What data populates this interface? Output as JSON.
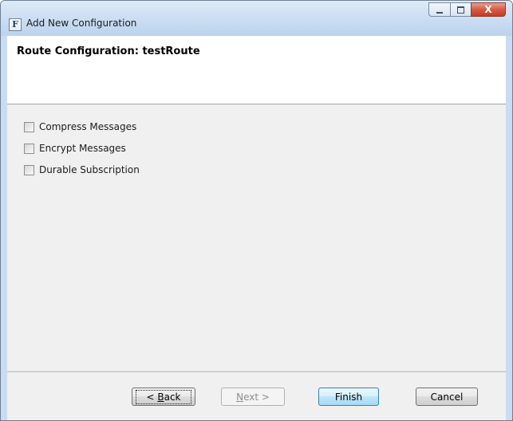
{
  "window": {
    "title": "Add New Configuration",
    "app_icon_letter": "F",
    "controls": {
      "minimize": "minimize-icon",
      "maximize": "maximize-icon",
      "close": "close-icon",
      "close_glyph": "X"
    }
  },
  "header": {
    "title": "Route Configuration: testRoute"
  },
  "options": [
    {
      "label": "Compress Messages",
      "checked": false
    },
    {
      "label": "Encrypt Messages",
      "checked": false
    },
    {
      "label": "Durable Subscription",
      "checked": false
    }
  ],
  "buttons": {
    "back": {
      "mnemonic": "B",
      "rest": "ack",
      "prefix": "< "
    },
    "next": {
      "mnemonic": "N",
      "rest": "ext >"
    },
    "finish": "Finish",
    "cancel": "Cancel"
  },
  "colors": {
    "titlebar": "#cddff3",
    "content_bg": "#f0f0f0",
    "close_button": "#c43b26",
    "default_button_border": "#3c7fb1"
  }
}
